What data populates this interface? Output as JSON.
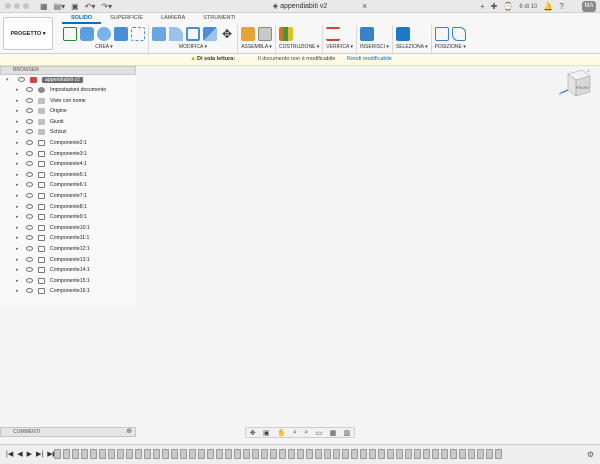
{
  "window": {
    "title": "appendiabiti v2",
    "tab_count": "6 di 10",
    "user_initials": "MA"
  },
  "toolbar": {
    "project_button": "PROGETTO ▾",
    "tabs": [
      {
        "label": "SOLIDO",
        "active": true
      },
      {
        "label": "SUPERFICIE",
        "active": false
      },
      {
        "label": "LAMIERA",
        "active": false
      },
      {
        "label": "STRUMENTI",
        "active": false
      }
    ],
    "groups": [
      {
        "label": "CREA ▾",
        "icons": [
          "sketch-icon",
          "extrude-icon",
          "revolve-icon",
          "box-icon",
          "pattern-icon"
        ]
      },
      {
        "label": "MODIFICA ▾",
        "icons": [
          "press-pull-icon",
          "fillet-icon",
          "shell-icon",
          "split-icon",
          "move-icon"
        ]
      },
      {
        "label": "ASSEMBLA ▾",
        "icons": [
          "new-component-icon",
          "joint-icon"
        ]
      },
      {
        "label": "COSTRUZIONE ▾",
        "icons": [
          "plane-icon"
        ]
      },
      {
        "label": "VERIFICA ▾",
        "icons": [
          "measure-icon"
        ]
      },
      {
        "label": "INSERISCI ▾",
        "icons": [
          "insert-image-icon"
        ]
      },
      {
        "label": "SELEZIONA ▾",
        "icons": [
          "select-icon"
        ]
      },
      {
        "label": "POSIZIONE ▾",
        "icons": [
          "position-icon",
          "capture-icon"
        ]
      }
    ],
    "accent_color": "#0b6ec4"
  },
  "readonly_bar": {
    "warning": "Di sola lettura:",
    "message": "Il documento non è modificabile",
    "action": "Rendi modificabile"
  },
  "browser": {
    "header": "BROWSER",
    "root": "appendiabiti v2",
    "items": [
      {
        "label": "Impostazioni documento",
        "icon": "gear-icon"
      },
      {
        "label": "Viste con nome",
        "icon": "folder-icon"
      },
      {
        "label": "Origine",
        "icon": "folder-icon"
      },
      {
        "label": "Giunti",
        "icon": "folder-icon"
      },
      {
        "label": "Schizzi",
        "icon": "folder-icon"
      },
      {
        "label": "Componente2:1",
        "icon": "component-icon"
      },
      {
        "label": "Componente3:1",
        "icon": "component-icon"
      },
      {
        "label": "Componente4:1",
        "icon": "component-icon"
      },
      {
        "label": "Componente5:1",
        "icon": "component-icon"
      },
      {
        "label": "Componente6:1",
        "icon": "component-icon"
      },
      {
        "label": "Componente7:1",
        "icon": "component-icon"
      },
      {
        "label": "Componente8:1",
        "icon": "component-icon"
      },
      {
        "label": "Componente9:1",
        "icon": "component-icon"
      },
      {
        "label": "Componente10:1",
        "icon": "component-icon"
      },
      {
        "label": "Componente11:1",
        "icon": "component-icon"
      },
      {
        "label": "Componente12:1",
        "icon": "component-icon"
      },
      {
        "label": "Componente13:1",
        "icon": "component-icon"
      },
      {
        "label": "Componente14:1",
        "icon": "component-icon"
      },
      {
        "label": "Componente15:1",
        "icon": "component-icon"
      },
      {
        "label": "Componente16:1",
        "icon": "component-icon"
      }
    ]
  },
  "comments": {
    "label": "COMMENTI"
  },
  "viewcube": {
    "face_label": "FRONT"
  },
  "timeline": {
    "controls": [
      "|◀",
      "◀",
      "▶",
      "▶|",
      "▶▶"
    ]
  }
}
